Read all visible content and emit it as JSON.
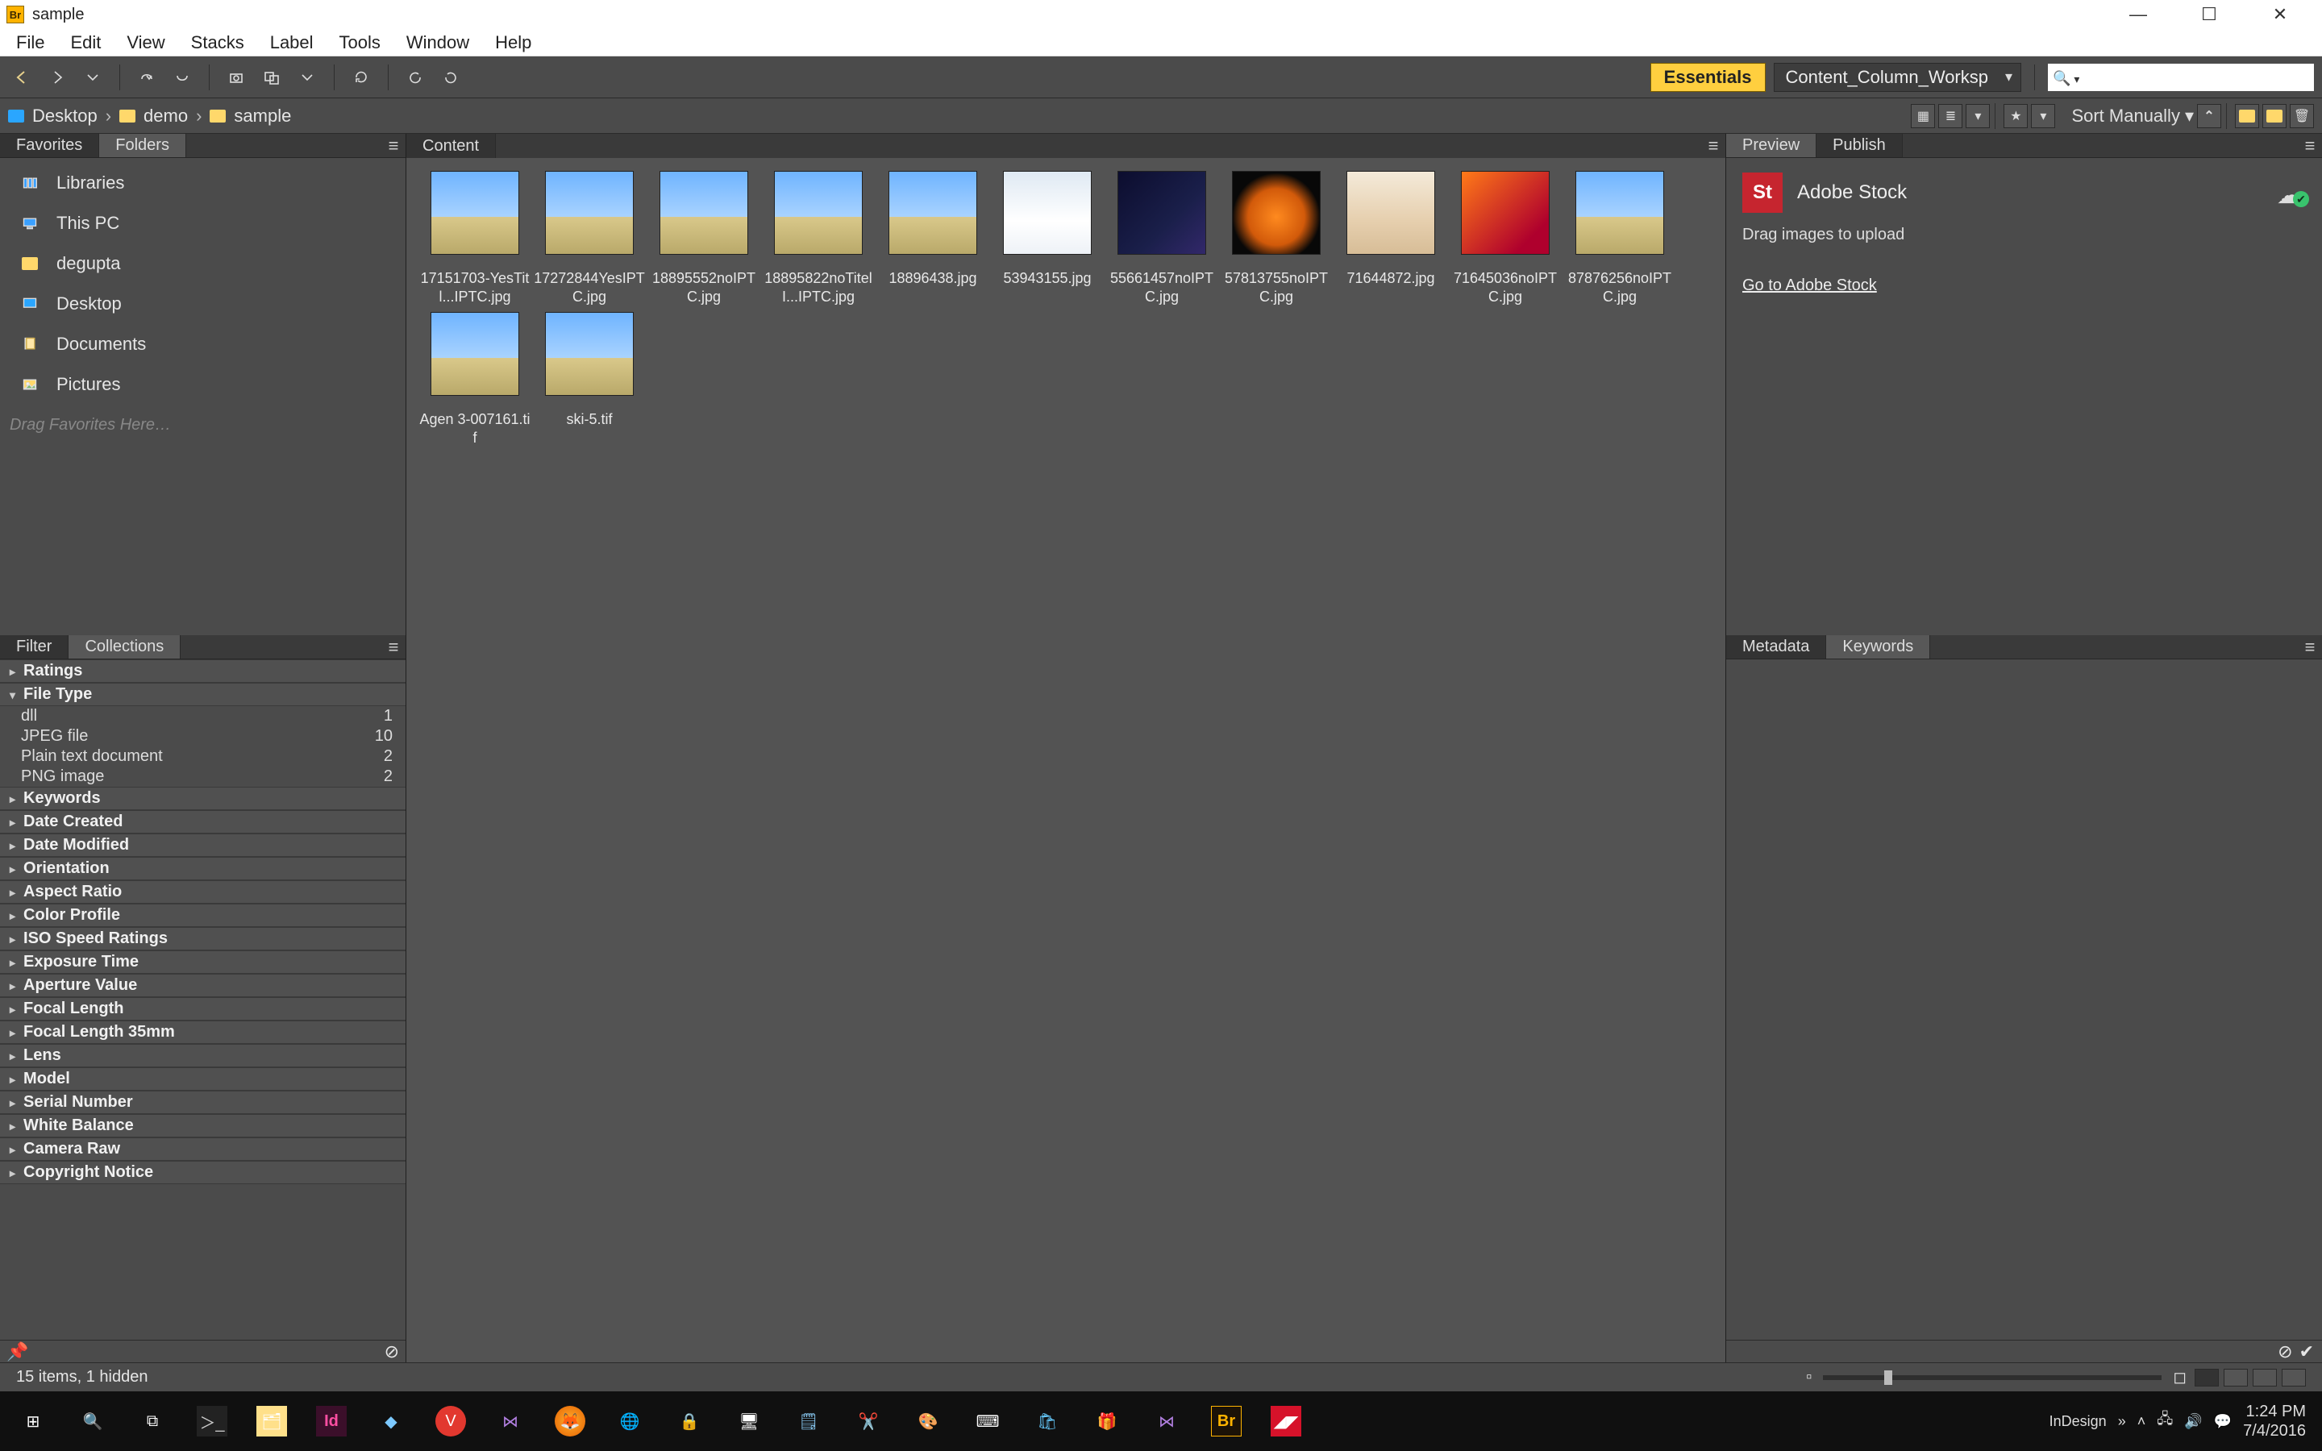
{
  "window": {
    "title": "sample",
    "app_badge": "Br"
  },
  "menu": [
    "File",
    "Edit",
    "View",
    "Stacks",
    "Label",
    "Tools",
    "Window",
    "Help"
  ],
  "toolbar": {
    "essentials": "Essentials",
    "workspace": "Content_Column_Worksp",
    "search_placeholder": ""
  },
  "breadcrumbs": [
    {
      "label": "Desktop",
      "color": "blue"
    },
    {
      "label": "demo",
      "color": "yellow"
    },
    {
      "label": "sample",
      "color": "yellow"
    }
  ],
  "sort": {
    "label": "Sort Manually"
  },
  "left": {
    "tabs": [
      "Favorites",
      "Folders"
    ],
    "active_tab": 0,
    "favorites": [
      {
        "label": "Libraries",
        "icon": "libraries"
      },
      {
        "label": "This PC",
        "icon": "thispc"
      },
      {
        "label": "degupta",
        "icon": "folder"
      },
      {
        "label": "Desktop",
        "icon": "desktop"
      },
      {
        "label": "Documents",
        "icon": "documents"
      },
      {
        "label": "Pictures",
        "icon": "pictures"
      }
    ],
    "drag_hint": "Drag Favorites Here…",
    "filter_tabs": [
      "Filter",
      "Collections"
    ],
    "filter_active": 0,
    "filters": [
      {
        "label": "Ratings",
        "open": false
      },
      {
        "label": "File Type",
        "open": true,
        "rows": [
          {
            "label": "dll",
            "count": 1
          },
          {
            "label": "JPEG file",
            "count": 10
          },
          {
            "label": "Plain text document",
            "count": 2
          },
          {
            "label": "PNG image",
            "count": 2
          }
        ]
      },
      {
        "label": "Keywords",
        "open": false
      },
      {
        "label": "Date Created",
        "open": false
      },
      {
        "label": "Date Modified",
        "open": false
      },
      {
        "label": "Orientation",
        "open": false
      },
      {
        "label": "Aspect Ratio",
        "open": false
      },
      {
        "label": "Color Profile",
        "open": false
      },
      {
        "label": "ISO Speed Ratings",
        "open": false
      },
      {
        "label": "Exposure Time",
        "open": false
      },
      {
        "label": "Aperture Value",
        "open": false
      },
      {
        "label": "Focal Length",
        "open": false
      },
      {
        "label": "Focal Length 35mm",
        "open": false
      },
      {
        "label": "Lens",
        "open": false
      },
      {
        "label": "Model",
        "open": false
      },
      {
        "label": "Serial Number",
        "open": false
      },
      {
        "label": "White Balance",
        "open": false
      },
      {
        "label": "Camera Raw",
        "open": false
      },
      {
        "label": "Copyright Notice",
        "open": false
      }
    ]
  },
  "content": {
    "tab": "Content",
    "thumbs": [
      {
        "name": "17151703-YesTitl...IPTC.jpg",
        "palette": "sky"
      },
      {
        "name": "17272844YesIPTC.jpg",
        "palette": "sky"
      },
      {
        "name": "18895552noIPTC.jpg",
        "palette": "sky"
      },
      {
        "name": "18895822noTitelI...IPTC.jpg",
        "palette": "sky"
      },
      {
        "name": "18896438.jpg",
        "palette": "sky"
      },
      {
        "name": "53943155.jpg",
        "palette": "snow"
      },
      {
        "name": "55661457noIPTC.jpg",
        "palette": "dark"
      },
      {
        "name": "57813755noIPTC.jpg",
        "palette": "pumpkin"
      },
      {
        "name": "71644872.jpg",
        "palette": "baby"
      },
      {
        "name": "71645036noIPTC.jpg",
        "palette": "orange"
      },
      {
        "name": "87876256noIPTC.jpg",
        "palette": "sky"
      },
      {
        "name": "Agen 3-007161.tif",
        "palette": "sky"
      },
      {
        "name": "ski-5.tif",
        "palette": "sky"
      }
    ]
  },
  "status": {
    "text": "15 items, 1 hidden"
  },
  "right": {
    "top_tabs": [
      "Preview",
      "Publish"
    ],
    "top_active": 1,
    "stock_title": "Adobe Stock",
    "stock_hint": "Drag images to upload",
    "stock_link": "Go to Adobe Stock",
    "bottom_tabs": [
      "Metadata",
      "Keywords"
    ],
    "bottom_active": 0
  },
  "taskbar": {
    "time": "1:24 PM",
    "date": "7/4/2016",
    "boomerang_label": "InDesign"
  }
}
